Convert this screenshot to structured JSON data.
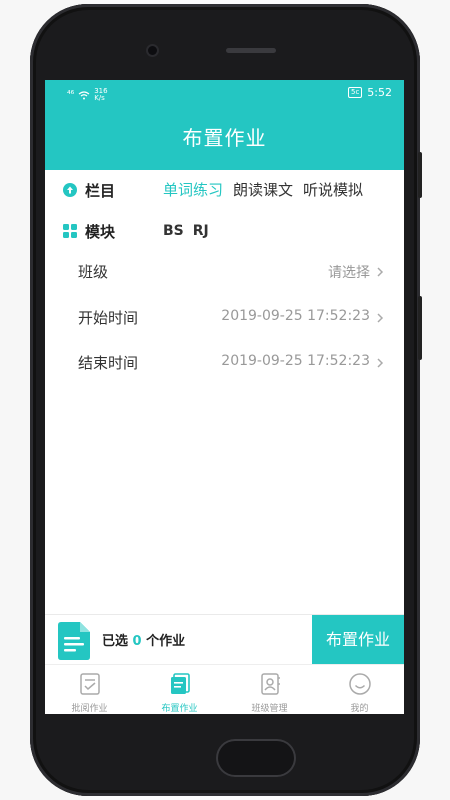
{
  "colors": {
    "accent": "#24c6c2",
    "text": "#333333",
    "muted": "#999999"
  },
  "status_bar": {
    "signal": "⁴⁶",
    "speed_value": "316",
    "speed_unit": "K/s",
    "battery": "5c",
    "time": "5:52"
  },
  "header": {
    "title": "布置作业"
  },
  "category_row": {
    "label": "栏目",
    "icon": "arrow-up-circle-icon",
    "tabs": [
      {
        "label": "单词练习",
        "active": true
      },
      {
        "label": "朗读课文",
        "active": false
      },
      {
        "label": "听说模拟",
        "active": false
      }
    ]
  },
  "module_row": {
    "label": "模块",
    "icon": "grid-icon",
    "items": [
      "BS",
      "RJ"
    ]
  },
  "form": {
    "class_label": "班级",
    "class_value": "请选择",
    "start_label": "开始时间",
    "start_value": "2019-09-25 17:52:23",
    "end_label": "结束时间",
    "end_value": "2019-09-25 17:52:23"
  },
  "bottom_bar": {
    "selected_prefix": "已选",
    "selected_count": "0",
    "selected_suffix": "个作业",
    "assign_label": "布置作业"
  },
  "tabbar": {
    "items": [
      {
        "label": "批阅作业",
        "icon": "checklist-icon",
        "active": false
      },
      {
        "label": "布置作业",
        "icon": "document-stack-icon",
        "active": true
      },
      {
        "label": "班级管理",
        "icon": "contacts-book-icon",
        "active": false
      },
      {
        "label": "我的",
        "icon": "smiley-icon",
        "active": false
      }
    ]
  }
}
